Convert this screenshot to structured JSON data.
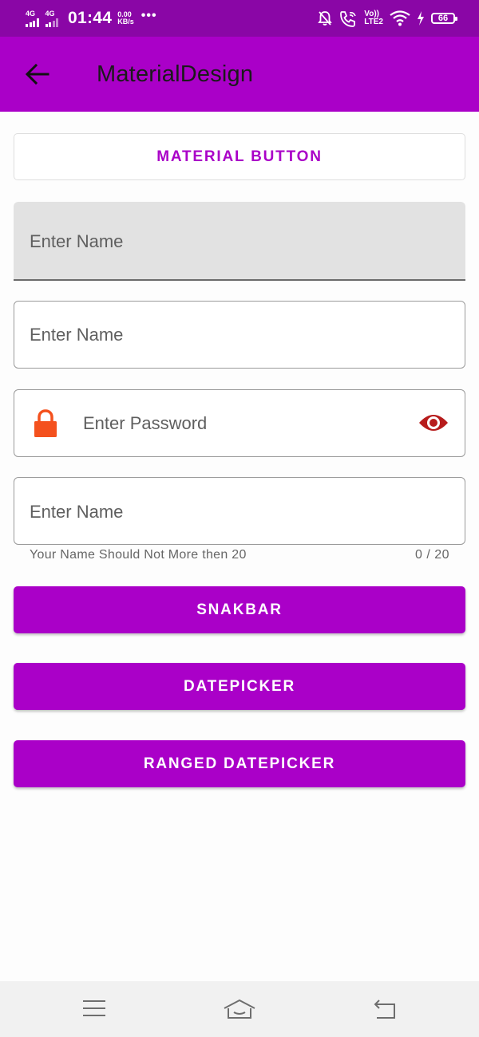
{
  "status_bar": {
    "network_1": "4G",
    "network_2": "4G",
    "time": "01:44",
    "speed_value": "0.00",
    "speed_unit": "KB/s",
    "more": "•••",
    "volte_top": "Vo))",
    "volte_bottom": "LTE2",
    "battery": "66"
  },
  "app_bar": {
    "title": "MaterialDesign"
  },
  "content": {
    "material_button": "MATERIAL BUTTON",
    "filled_name_hint": "Enter Name",
    "outlined_name_hint": "Enter Name",
    "password_hint": "Enter Password",
    "counter_name_hint": "Enter Name",
    "helper_text": "Your Name Should Not More then 20",
    "counter_text": "0 / 20",
    "snackbar_button": "SNAKBAR",
    "datepicker_button": "DATEPICKER",
    "ranged_datepicker_button": "RANGED DATEPICKER"
  },
  "colors": {
    "status_bar": "#8a06a6",
    "accent": "#aa00c8",
    "lock_icon": "#f4511e",
    "eye_icon": "#b71c1c"
  },
  "icons": {
    "back": "arrow-left-icon",
    "lock": "lock-icon",
    "eye": "eye-icon",
    "nav_menu": "menu-icon",
    "nav_home": "home-icon",
    "nav_back": "return-icon"
  }
}
